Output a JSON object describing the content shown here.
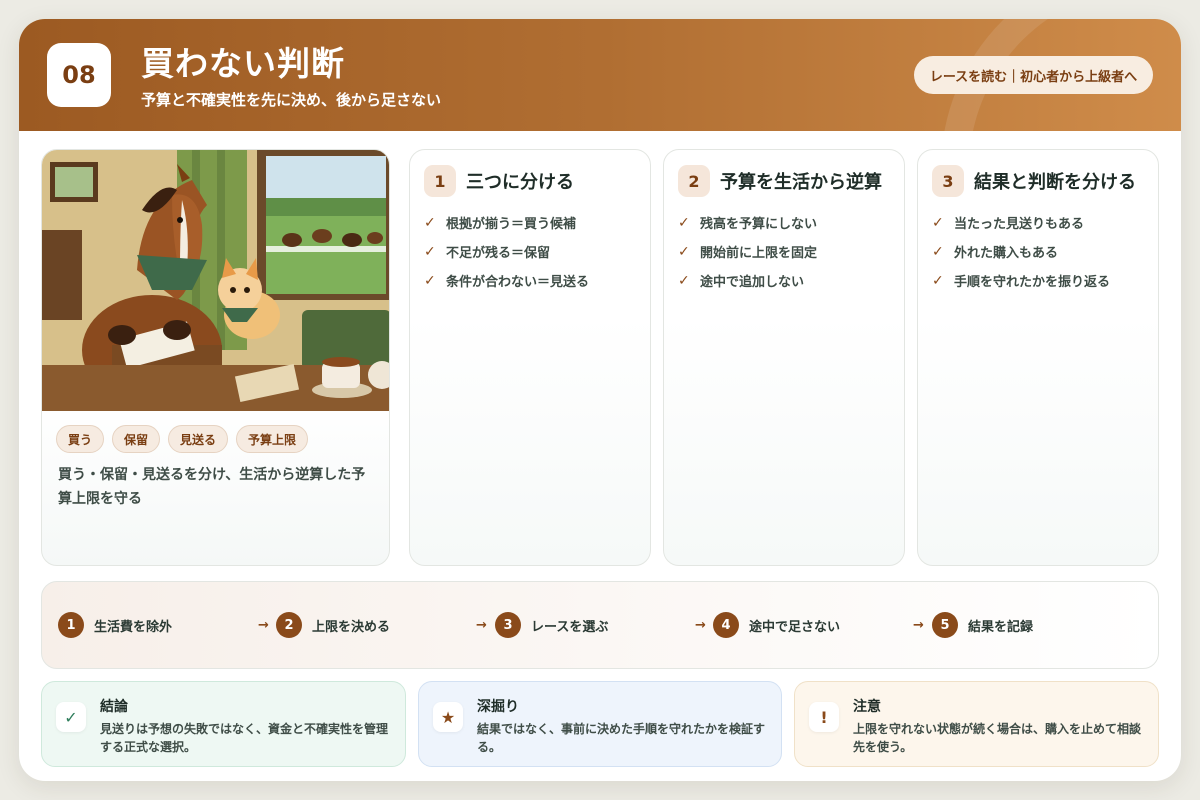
{
  "header": {
    "number": "08",
    "title": "買わない判断",
    "subtitle": "予算と不確実性を先に決め、後から足さない",
    "level": "レースを読む｜初心者から上級者へ"
  },
  "image_card": {
    "tags": [
      "買う",
      "保留",
      "見送る",
      "予算上限"
    ],
    "description": "買う・保留・見送るを分け、生活から逆算した予算上限を守る"
  },
  "steps": [
    {
      "num": "1",
      "title": "三つに分ける",
      "items": [
        "根拠が揃う＝買う候補",
        "不足が残る＝保留",
        "条件が合わない＝見送る"
      ]
    },
    {
      "num": "2",
      "title": "予算を生活から逆算",
      "items": [
        "残高を予算にしない",
        "開始前に上限を固定",
        "途中で追加しない"
      ]
    },
    {
      "num": "3",
      "title": "結果と判断を分ける",
      "items": [
        "当たった見送りもある",
        "外れた購入もある",
        "手順を守れたかを振り返る"
      ]
    }
  ],
  "flow": {
    "steps": [
      {
        "num": "1",
        "label": "生活費を除外"
      },
      {
        "num": "2",
        "label": "上限を決める"
      },
      {
        "num": "3",
        "label": "レースを選ぶ"
      },
      {
        "num": "4",
        "label": "途中で足さない"
      },
      {
        "num": "5",
        "label": "結果を記録"
      }
    ],
    "arrow": "→"
  },
  "notes": [
    {
      "icon": "✓",
      "title": "結論",
      "text": "見送りは予想の失敗ではなく、資金と不確実性を管理する正式な選択。",
      "bg": "#eef8f3",
      "border": "#cfe9dc",
      "icon_color": "#2e7d5b"
    },
    {
      "icon": "★",
      "title": "深掘り",
      "text": "結果ではなく、事前に決めた手順を守れたかを検証する。",
      "bg": "#eef4fc",
      "border": "#d3e1f3",
      "icon_color": "#8a4a1a"
    },
    {
      "icon": "!",
      "title": "注意",
      "text": "上限を守れない状態が続く場合は、購入を止めて相談先を使う。",
      "bg": "#fdf6ec",
      "border": "#f0e1c8",
      "icon_color": "#8a4a1a"
    }
  ]
}
